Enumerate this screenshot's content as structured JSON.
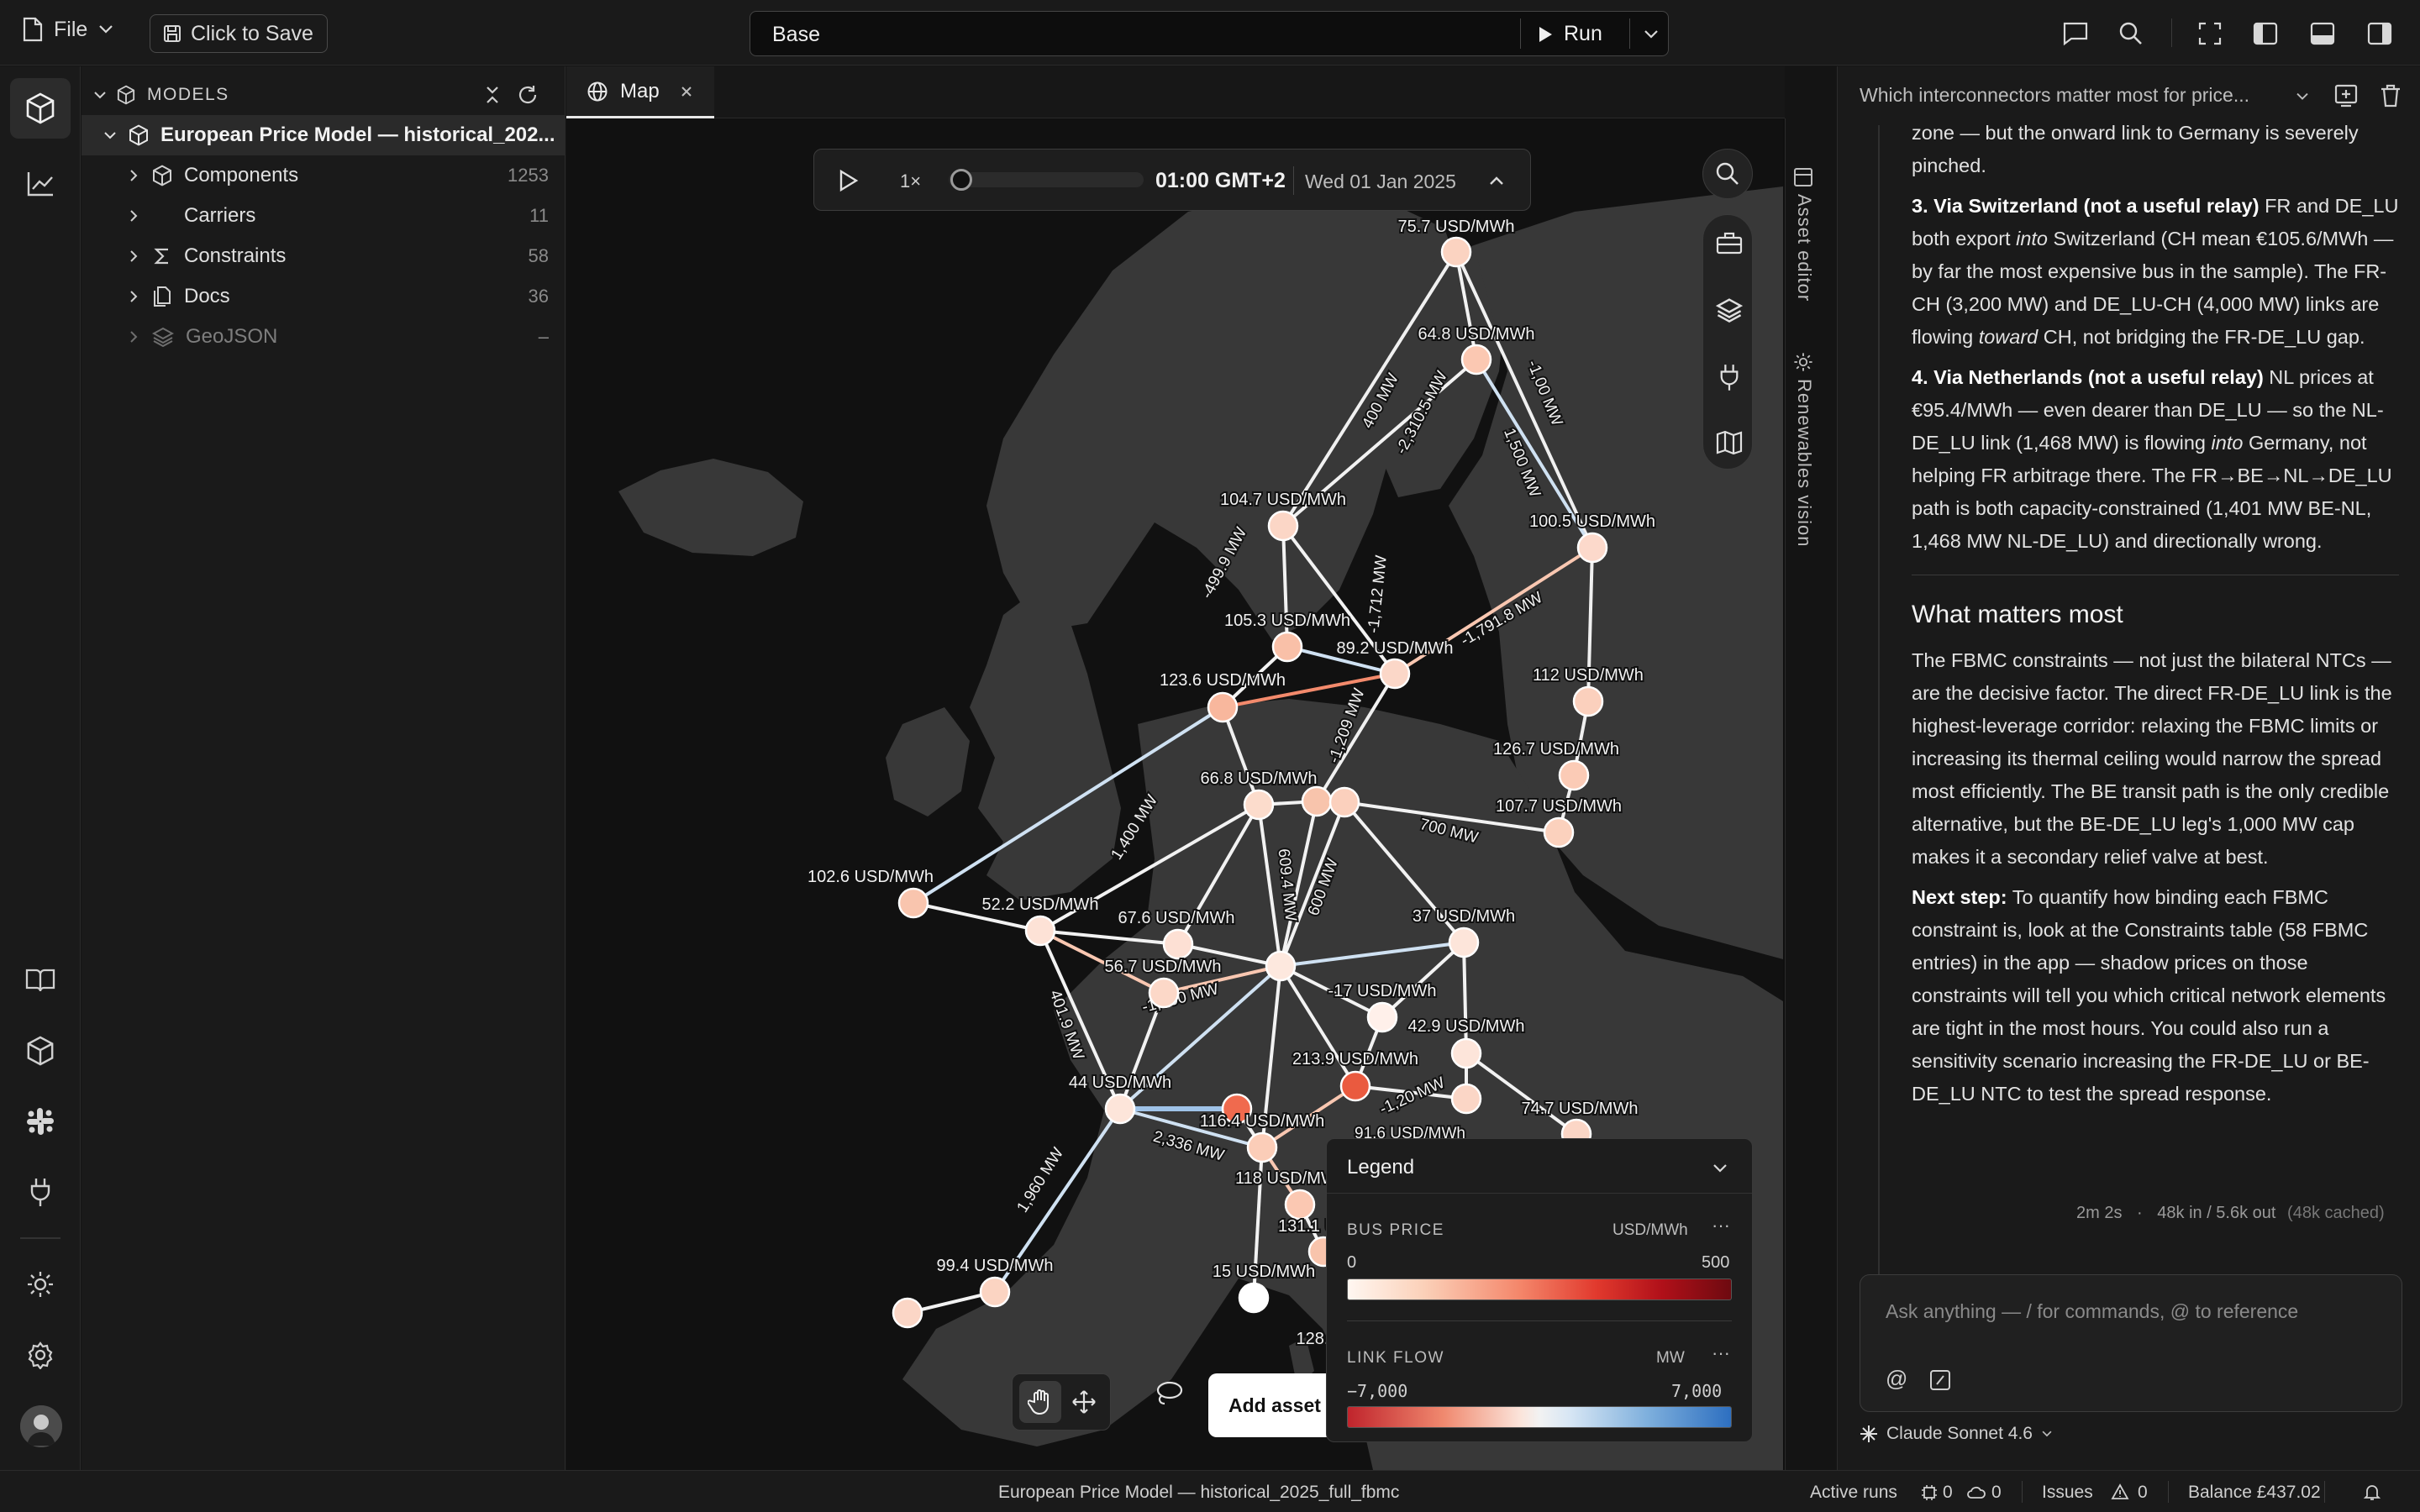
{
  "topbar": {
    "file_label": "File",
    "save_label": "Click to Save",
    "scenario": "Base",
    "run_label": "Run"
  },
  "models_panel": {
    "header": "MODELS",
    "model_name": "European Price Model — historical_202...",
    "items": [
      {
        "label": "Components",
        "count": "1253"
      },
      {
        "label": "Carriers",
        "count": "11"
      },
      {
        "label": "Constraints",
        "count": "58"
      },
      {
        "label": "Docs",
        "count": "36"
      },
      {
        "label": "GeoJSON",
        "count": "–"
      }
    ]
  },
  "map": {
    "tab_label": "Map",
    "speed": "1×",
    "time": "01:00 GMT+2",
    "date": "Wed 01 Jan 2025",
    "side_tabs": [
      "Asset editor",
      "Renewables vision"
    ],
    "add_asset": "Add asset",
    "bus_labels": [
      "75.7 USD/MWh",
      "64.8 USD/MWh",
      "104.7 USD/MWh",
      "100.5 USD/MWh",
      "105.3 USD/MWh",
      "89.2 USD/MWh",
      "123.6 USD/MWh",
      "112 USD/MWh",
      "126.7 USD/MWh",
      "66.8 USD/MWh",
      "107.7 USD/MWh",
      "102.6 USD/MWh",
      "52.2 USD/MWh",
      "67.6 USD/MWh",
      "37 USD/MWh",
      "56.7 USD/MWh",
      "-17 USD/MWh",
      "42.9 USD/MWh",
      "213.9 USD/MWh",
      "44 USD/MWh",
      "116.4 USD/MWh",
      "74.7 USD/MWh",
      "118 USD/MWh",
      "131.1 U",
      "99.4 USD/MWh",
      "15 USD/MWh",
      "128."
    ],
    "flow_labels": [
      "400 MW",
      "-2,310.5 MW",
      "-1,00 MW",
      "1,500 MW",
      "-499.9 MW",
      "-1,712 MW",
      "-1,791.8 MW",
      "-1,209 MW",
      "1,400 MW",
      "609.4 MW",
      "600 MW",
      "700 MW",
      "401.9 MW",
      "-1,000 MW",
      "2,336 MW",
      "1,960 MW",
      "-1,20 MW",
      "91.6 USD/MWh"
    ],
    "legend": {
      "title": "Legend",
      "bus_price_label": "BUS PRICE",
      "bus_price_unit": "USD/MWh",
      "bus_price_min": "0",
      "bus_price_max": "500",
      "link_flow_label": "LINK FLOW",
      "link_flow_unit": "MW",
      "link_flow_min": "−7,000",
      "link_flow_max": "7,000"
    }
  },
  "chat": {
    "thread_title": "Which interconnectors matter most for price...",
    "p_cont": "zone — but the onward link to Germany is severely pinched.",
    "p3_head": "3. Via Switzerland (not a useful relay)",
    "p3_a": " FR and DE_LU both export ",
    "p3_em1": "into",
    "p3_b": " Switzerland (CH mean €105.6/MWh — by far the most expensive bus in the sample). The FR-CH (3,200 MW) and DE_LU-CH (4,000 MW) links are flowing ",
    "p3_em2": "toward",
    "p3_c": " CH, not bridging the FR-DE_LU gap.",
    "p4_head": "4. Via Netherlands (not a useful relay)",
    "p4_a": " NL prices at €95.4/MWh — even dearer than DE_LU — so the NL-DE_LU link (1,468 MW) is flowing ",
    "p4_em": "into",
    "p4_b": " Germany, not helping FR arbitrage there. The FR→BE→NL→DE_LU path is both capacity-constrained (1,401 MW BE-NL, 1,468 MW NL-DE_LU) and directionally wrong.",
    "section_title": "What matters most",
    "p5": "The FBMC constraints — not just the bilateral NTCs — are the decisive factor. The direct FR-DE_LU link is the highest-leverage corridor: relaxing the FBMC limits or increasing its thermal ceiling would narrow the spread most efficiently. The BE transit path is the only credible alternative, but the BE-DE_LU leg's 1,000 MW cap makes it a secondary relief valve at best.",
    "p6_head": "Next step:",
    "p6": " To quantify how binding each FBMC constraint is, look at the Constraints table (58 FBMC entries) in the app — shadow prices on those constraints will tell you which critical network elements are tight in the most hours. You could also run a sensitivity scenario increasing the FR-DE_LU or BE-DE_LU NTC to test the spread response.",
    "meta_time": "2m 2s",
    "meta_tokens": "48k in / 5.6k out",
    "meta_cached": "(48k cached)",
    "input_placeholder": "Ask anything — / for commands, @ to reference",
    "model": "Claude Sonnet 4.6"
  },
  "status": {
    "model_title": "European Price Model — historical_2025_full_fbmc",
    "active_runs": "Active runs",
    "runs_a": "0",
    "runs_b": "0",
    "issues": "Issues",
    "issues_count": "0",
    "balance": "Balance £437.02"
  },
  "colors": {
    "accent_link_blue": "#9fc3e8",
    "price_low": "#fff5ee",
    "price_high": "#8b0a12",
    "flow_neg": "#c0242c",
    "flow_pos": "#2d6fc0"
  }
}
